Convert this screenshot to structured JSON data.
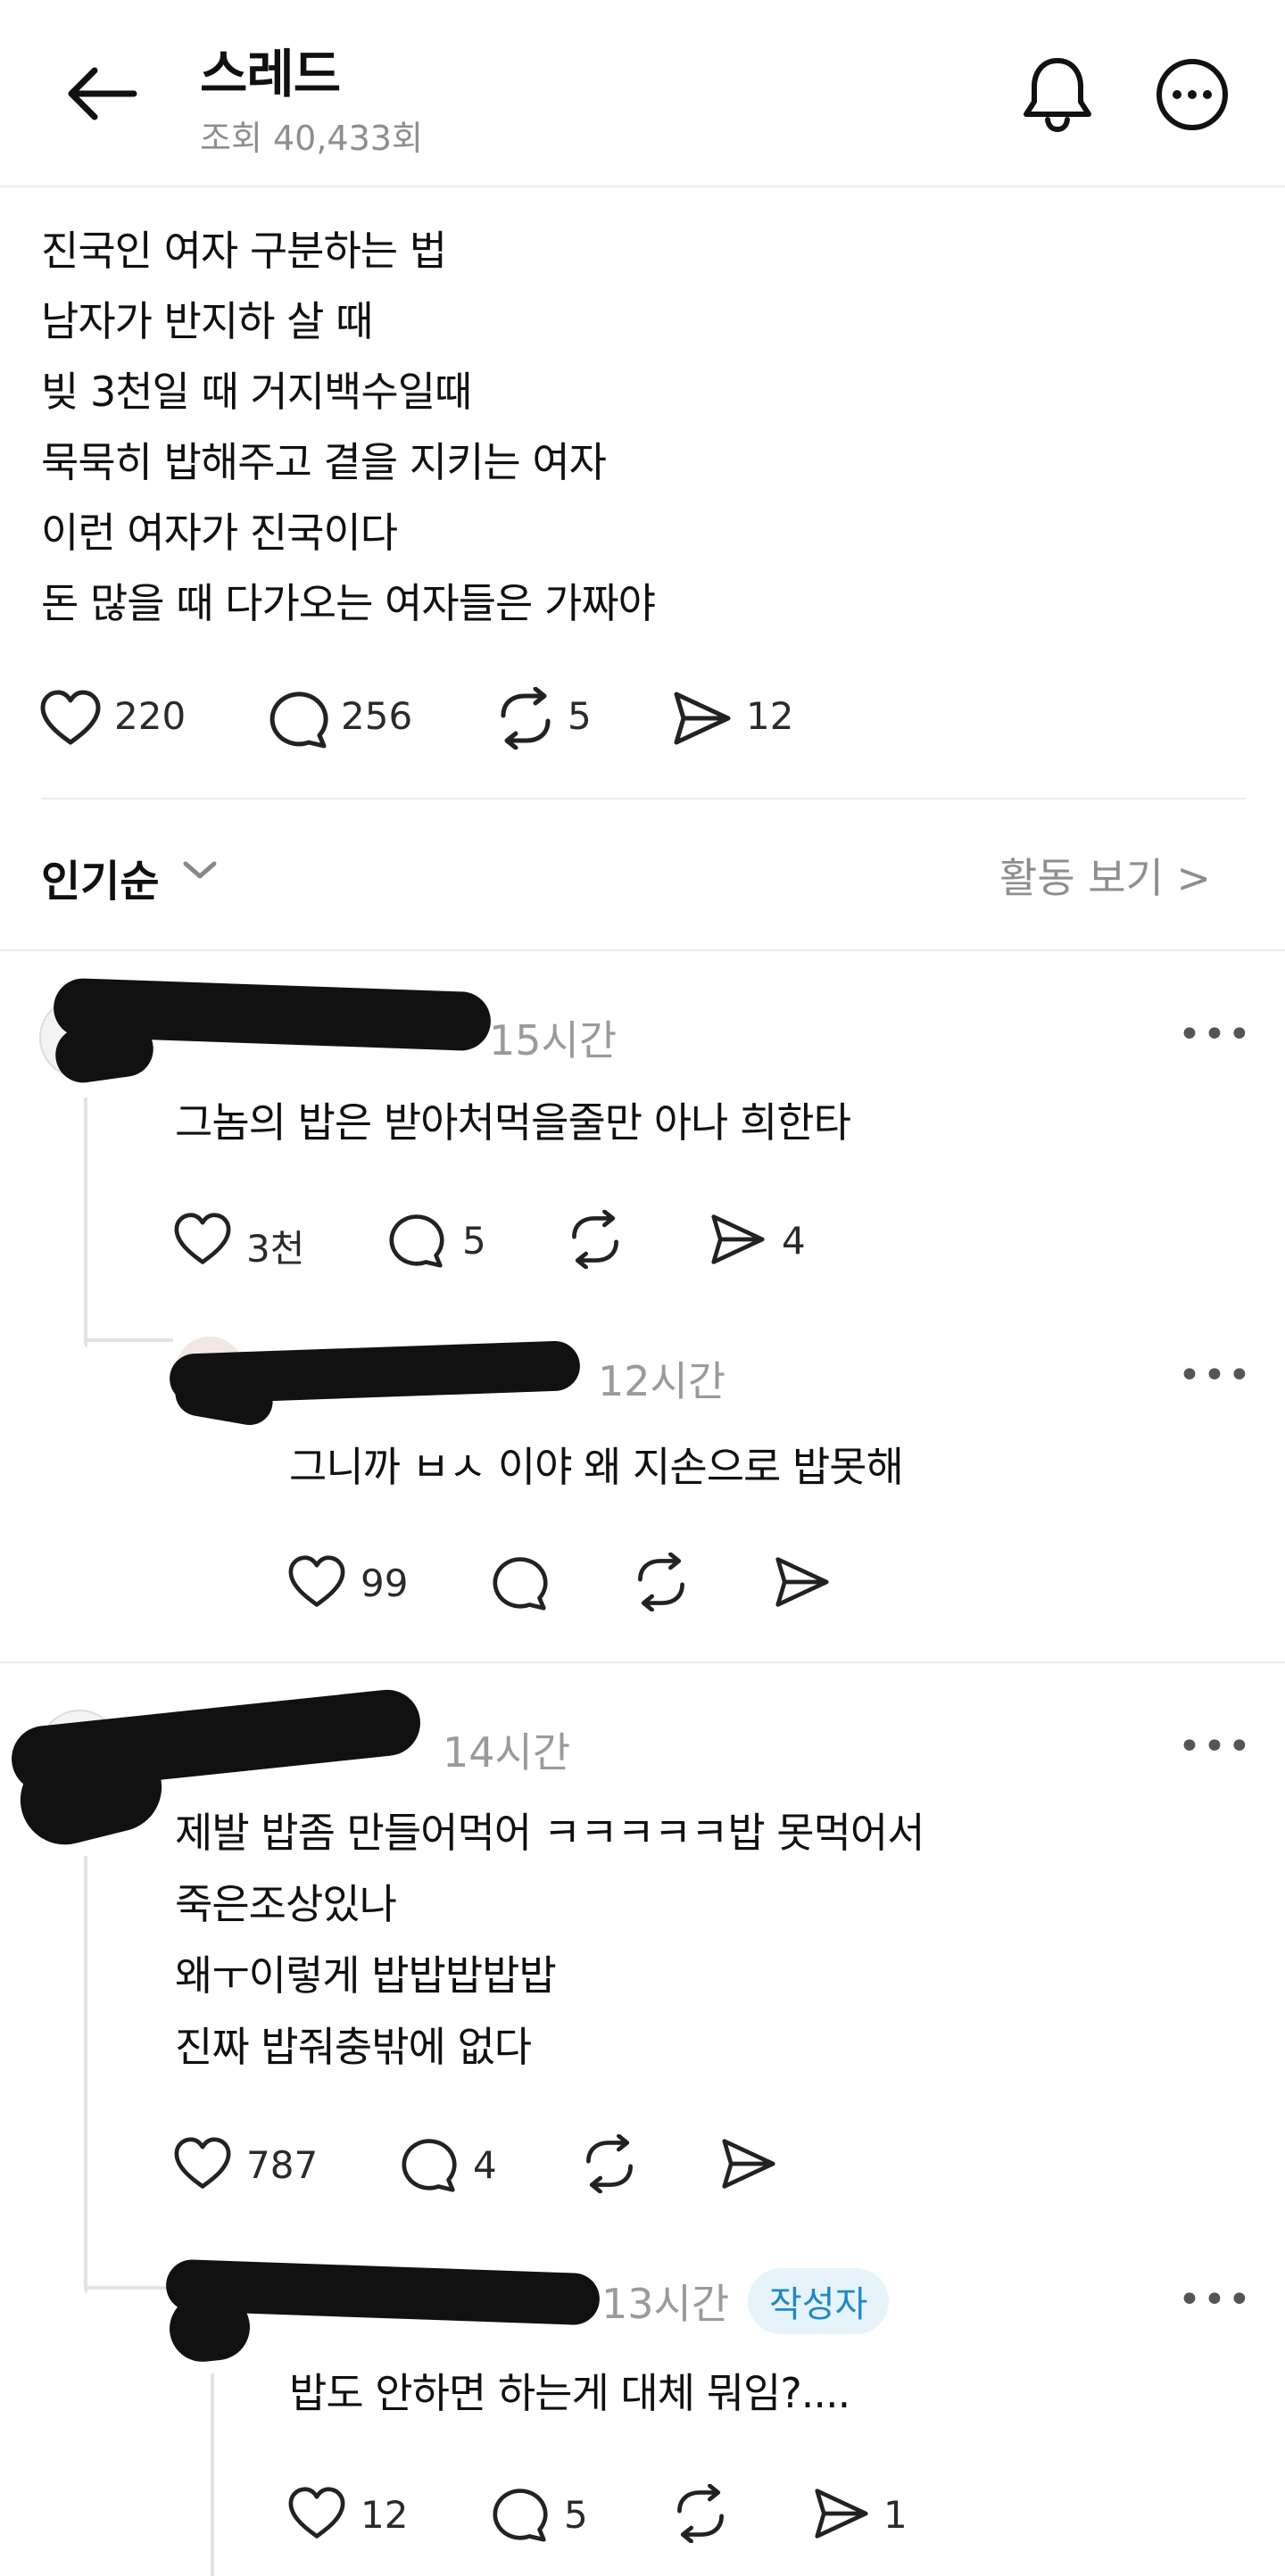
{
  "header": {
    "title": "스레드",
    "views": "조회 40,433회",
    "back_icon": "back-arrow-icon",
    "bell_icon": "bell-icon",
    "more_icon": "more-icon"
  },
  "post": {
    "lines": [
      "진국인 여자 구분하는 법",
      "남자가 반지하 살 때",
      "빚 3천일 때 거지백수일때",
      "묵묵히 밥해주고 곁을 지키는 여자",
      "이런 여자가 진국이다",
      "돈 많을 때 다가오는 여자들은 가짜야"
    ],
    "likes": "220",
    "comments": "256",
    "reposts": "5",
    "shares": "12"
  },
  "sort": {
    "label": "인기순",
    "activity_link": "활동 보기 >"
  },
  "replies": [
    {
      "time": "15시간",
      "text": [
        "그놈의 밥은 받아처먹을줄만 아나 희한타"
      ],
      "likes": "3천",
      "comments": "5",
      "reposts": "",
      "shares": "4",
      "sub": {
        "time": "12시간",
        "text": [
          "그니까 ㅂㅅ 이야 왜 지손으로 밥못해"
        ],
        "likes": "99",
        "comments": "",
        "reposts": "",
        "shares": ""
      }
    },
    {
      "time": "14시간",
      "text": [
        "제발 밥좀 만들어먹어 ㅋㅋㅋㅋㅋ밥 못먹어서",
        "죽은조상있나",
        "왜ㅜ이렇게 밥밥밥밥밥",
        "진짜 밥줘충밖에 없다"
      ],
      "likes": "787",
      "comments": "4",
      "reposts": "",
      "shares": "",
      "sub": {
        "time": "13시간",
        "badge": "작성자",
        "text": [
          "밥도 안하면 하는게 대체 뭐임?...."
        ],
        "likes": "12",
        "comments": "5",
        "reposts": "",
        "shares": "1"
      }
    }
  ],
  "colors": {
    "text": "#101010",
    "muted": "#8e8e8e",
    "divider": "#ececec",
    "badge_text": "#1e88c8",
    "badge_bg": "#e6f3fb"
  }
}
